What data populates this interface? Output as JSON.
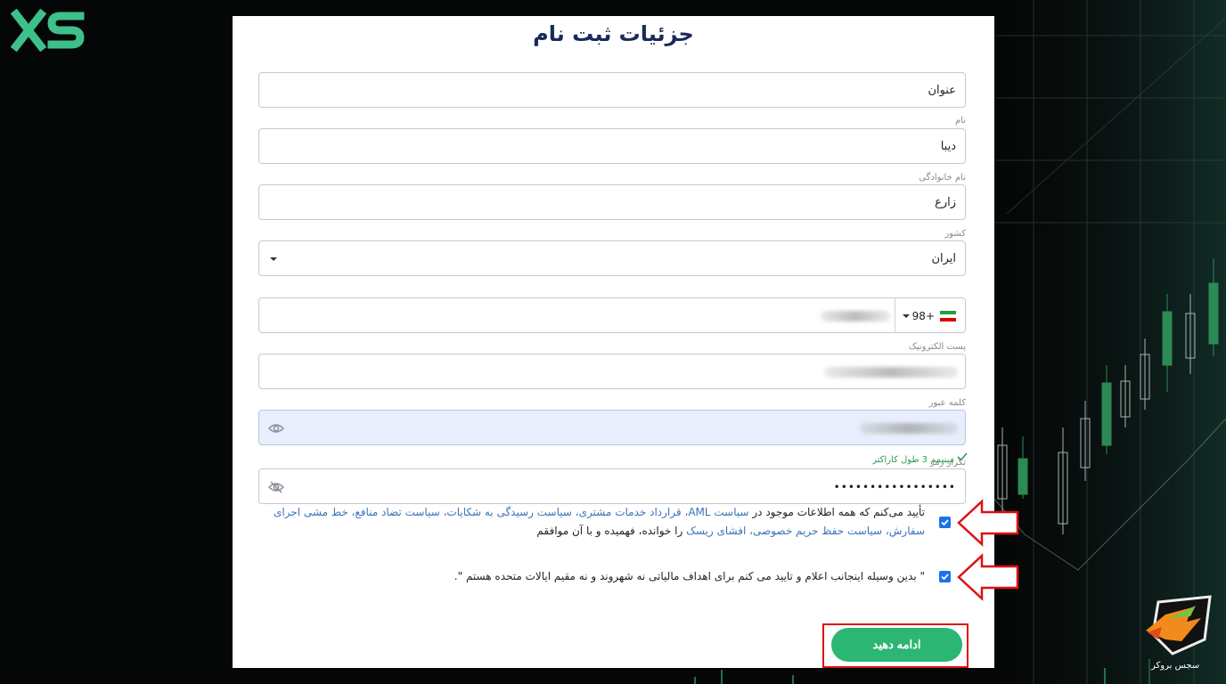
{
  "brand": {
    "logo_text": "XS"
  },
  "form": {
    "title": "جزئیات ثبت نام",
    "title_field": {
      "placeholder": "عنوان"
    },
    "first_name": {
      "label": "نام",
      "value": "دیبا"
    },
    "last_name": {
      "label": "نام خانوادگی",
      "value": "زارع"
    },
    "country": {
      "label": "کشور",
      "value": "ایران"
    },
    "phone": {
      "country_code": "98+",
      "flag": "iran-flag-icon"
    },
    "email": {
      "label": "پست الکترونیک"
    },
    "password": {
      "label": "کلمه عبور"
    },
    "confirm_password": {
      "label": "تکرار رمز",
      "hint": "مینیمم 3 طول کاراکتر",
      "value": "•••••••••••••••••"
    },
    "consent_1": {
      "prefix": "تأیید می‌کنم که همه اطلاعات موجود در ",
      "links_line1": "سیاست AML، قرارداد خدمات مشتری، سیاست رسیدگی به شکایات، سیاست تضاد منافع، خط مشی اجرای",
      "links_line2": "سفارش، سیاست حفظ حریم خصوصی، افشای ریسک",
      "suffix": " را خوانده، فهمیده و با آن موافقم",
      "checked": true
    },
    "consent_2": {
      "text": "\" بدین وسیله اینجانب اعلام و تایید می کنم برای اهداف مالیاتی نه شهروند و نه مقیم ایالات متحده هستم \".",
      "checked": true
    },
    "submit_label": "ادامه دهید"
  },
  "watermark": {
    "name": "سجس بروکر"
  },
  "colors": {
    "accent": "#2bb673",
    "title": "#1b2a5c",
    "link": "#3a74b8",
    "highlight": "#dd1111"
  }
}
